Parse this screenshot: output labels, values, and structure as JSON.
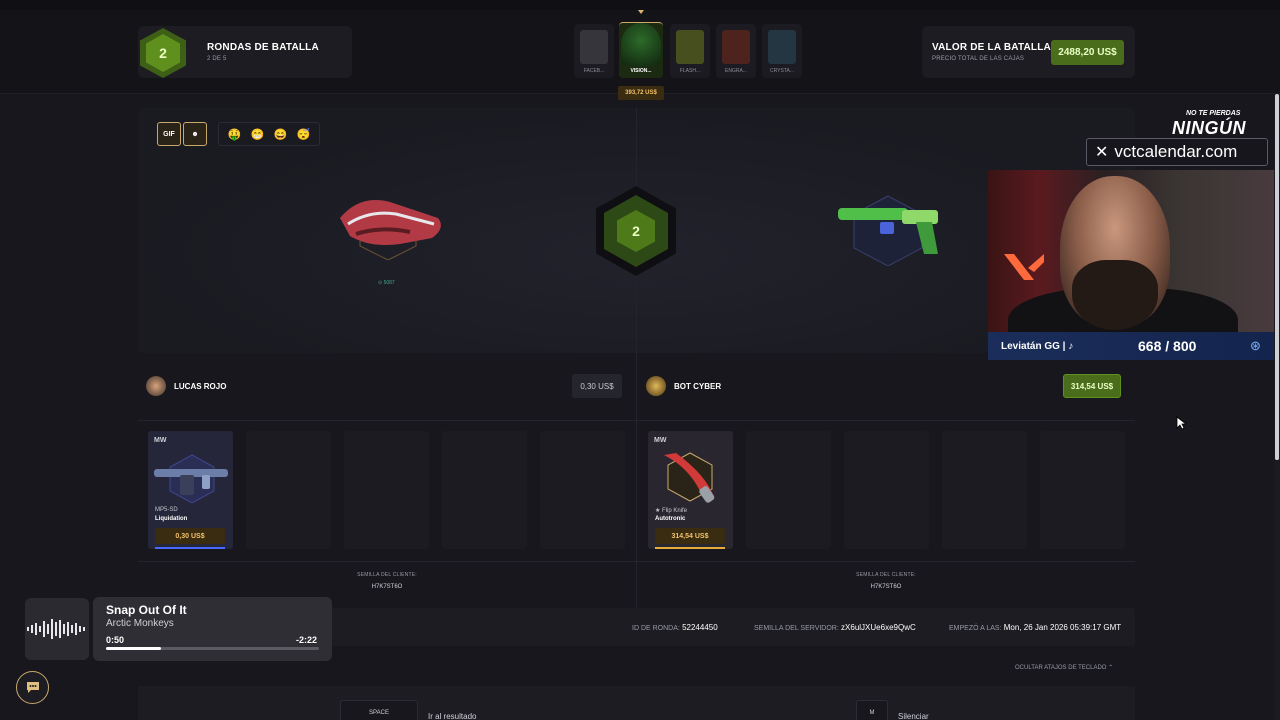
{
  "header": {
    "rounds": {
      "current": "2",
      "title": "RONDAS DE BATALLA",
      "subtitle": "2 DE 5"
    },
    "cases": [
      {
        "label": "FACEB..."
      },
      {
        "label": "VISION...",
        "price": "393,72 US$"
      },
      {
        "label": "FLASH..."
      },
      {
        "label": "ENGRA..."
      },
      {
        "label": "CRYSTA..."
      }
    ],
    "battle_value": {
      "title": "VALOR DE LA BATALLA",
      "subtitle": "PRECIO TOTAL DE LAS CAJAS",
      "amount": "2488,20 US$"
    }
  },
  "arena": {
    "emotes": {
      "gif_label": "GIF",
      "smile_icon": "smile-icon",
      "emojis": [
        "🤑",
        "😁",
        "😄",
        "😴"
      ]
    },
    "round_number": "2",
    "left_drop_float": "⊙ 5087"
  },
  "players": [
    {
      "name": "LUCAS ROJO",
      "total": "0,30 US$",
      "items": [
        {
          "wear": "MW",
          "weapon": "MP5-SD",
          "skin": "Liquidation",
          "price": "0,30 US$"
        }
      ],
      "seed_label": "SEMILLA DEL CLIENTE:",
      "seed": "H7K7ST6O"
    },
    {
      "name": "BOT CYBER",
      "total": "314,54 US$",
      "items": [
        {
          "wear": "MW",
          "weapon": "★ Flip Knife",
          "skin": "Autotronic",
          "price": "314,54 US$"
        }
      ],
      "seed_label": "SEMILLA DEL CLIENTE:",
      "seed": "H7K7ST6O"
    }
  ],
  "info": {
    "round_id_label": "ID DE RONDA:",
    "round_id": "52244450",
    "server_seed_label": "SEMILLA DEL SERVIDOR:",
    "server_seed": "zX6ulJXUe6xe9QwC",
    "started_label": "EMPEZÓ A LAS:",
    "started": "Mon, 26 Jan 2026 05:39:17 GMT"
  },
  "shortcuts": {
    "hide_label": "OCULTAR ATAJOS DE TECLADO",
    "items": [
      {
        "key": "SPACE",
        "desc": "Ir al resultado"
      },
      {
        "key": "M",
        "desc": "Silenciar"
      }
    ]
  },
  "overlay": {
    "sponsor": {
      "line1": "NO TE PIERDAS",
      "line2": "NINGÚN PARTIDO",
      "site": "vctcalendar.com"
    },
    "streamer": {
      "name": "Leviatán GG |",
      "count": "668 / 800"
    },
    "music": {
      "title": "Snap Out Of It",
      "artist": "Arctic Monkeys",
      "elapsed": "0:50",
      "remaining": "-2:22",
      "progress": 0.26
    }
  },
  "colors": {
    "accent_green": "#4a6d1c",
    "gold": "#f3c26b",
    "bg": "#17171d"
  }
}
